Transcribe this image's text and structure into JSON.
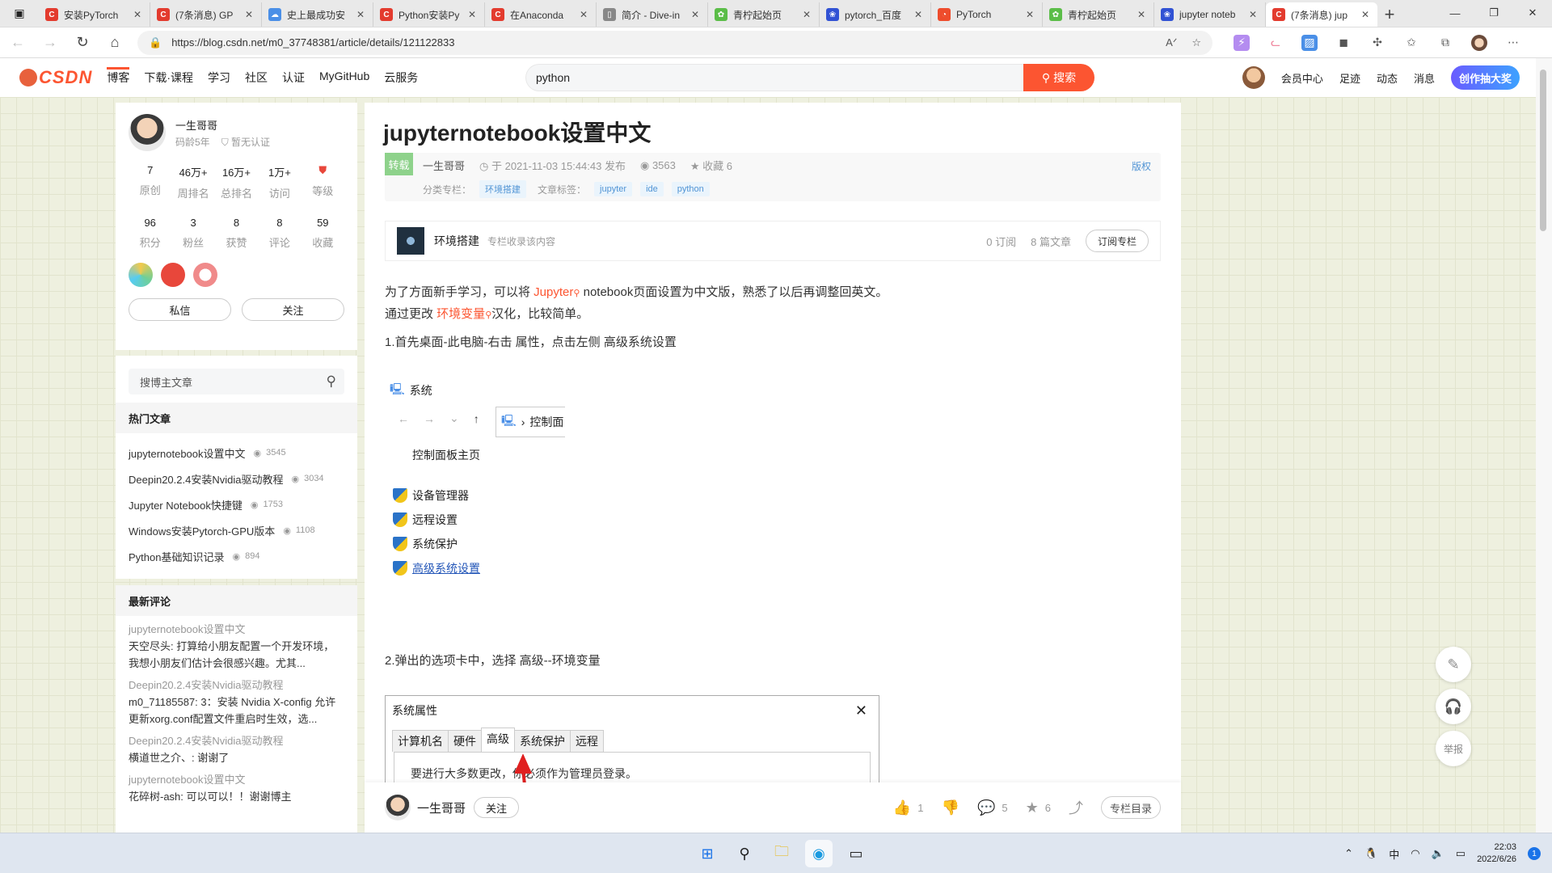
{
  "browser": {
    "tabs": [
      {
        "title": "安装PyTorch",
        "color": "#e33b2e",
        "glyph": "C"
      },
      {
        "title": "(7条消息) GP",
        "color": "#e33b2e",
        "glyph": "C"
      },
      {
        "title": "史上最成功安",
        "color": "#4a8fe7",
        "glyph": "☁"
      },
      {
        "title": "Python安装Py",
        "color": "#e33b2e",
        "glyph": "C"
      },
      {
        "title": "在Anaconda",
        "color": "#e33b2e",
        "glyph": "C"
      },
      {
        "title": "简介 - Dive-in",
        "color": "#888888",
        "glyph": "▯"
      },
      {
        "title": "青柠起始页",
        "color": "#5bbd48",
        "glyph": "✿"
      },
      {
        "title": "pytorch_百度",
        "color": "#3152d4",
        "glyph": "❀"
      },
      {
        "title": "PyTorch",
        "color": "#ee4c2c",
        "glyph": "◔"
      },
      {
        "title": "青柠起始页",
        "color": "#5bbd48",
        "glyph": "✿"
      },
      {
        "title": "jupyter noteb",
        "color": "#3152d4",
        "glyph": "❀"
      },
      {
        "title": "(7条消息) jup",
        "color": "#e33b2e",
        "glyph": "C"
      }
    ],
    "url": "https://blog.csdn.net/m0_37748381/article/details/121122833"
  },
  "csdn": {
    "logo": "CSDN",
    "nav": [
      "博客",
      "下载·课程",
      "学习",
      "社区",
      "认证",
      "MyGitHub",
      "云服务"
    ],
    "search_value": "python",
    "search_btn": "搜索",
    "right": [
      "会员中心",
      "足迹",
      "动态",
      "消息"
    ],
    "create_btn": "创作抽大奖"
  },
  "profile": {
    "name": "一生哥哥",
    "age": "码龄5年",
    "cert": "暂无认证",
    "stats": [
      {
        "v": "7",
        "l": "原创"
      },
      {
        "v": "46万+",
        "l": "周排名"
      },
      {
        "v": "16万+",
        "l": "总排名"
      },
      {
        "v": "1万+",
        "l": "访问"
      },
      {
        "v": "",
        "l": "等级"
      },
      {
        "v": "96",
        "l": "积分"
      },
      {
        "v": "3",
        "l": "粉丝"
      },
      {
        "v": "8",
        "l": "获赞"
      },
      {
        "v": "8",
        "l": "评论"
      },
      {
        "v": "59",
        "l": "收藏"
      }
    ],
    "btn_msg": "私信",
    "btn_follow": "关注"
  },
  "sidebar": {
    "search_placeholder": "搜博主文章",
    "hot_title": "热门文章",
    "hot": [
      {
        "t": "jupyternotebook设置中文",
        "v": "3545"
      },
      {
        "t": "Deepin20.2.4安装Nvidia驱动教程",
        "v": "3034"
      },
      {
        "t": "Jupyter Notebook快捷键",
        "v": "1753"
      },
      {
        "t": "Windows安装Pytorch-GPU版本",
        "v": "1108"
      },
      {
        "t": "Python基础知识记录",
        "v": "894"
      }
    ],
    "comments_title": "最新评论",
    "comments": [
      {
        "t": "jupyternotebook设置中文",
        "c": "天空尽头: 打算给小朋友配置一个开发环境，我想小朋友们估计会很感兴趣。尤其..."
      },
      {
        "t": "Deepin20.2.4安装Nvidia驱动教程",
        "c": "m0_71185587: 3：安装 Nvidia X-config 允许更新xorg.conf配置文件重启时生效，选..."
      },
      {
        "t": "Deepin20.2.4安装Nvidia驱动教程",
        "c": "横道世之介、: 谢谢了"
      },
      {
        "t": "jupyternotebook设置中文",
        "c": "花碎树-ash: 可以可以！！谢谢博主"
      }
    ]
  },
  "article": {
    "title": "jupyternotebook设置中文",
    "badge": "转载",
    "author": "一生哥哥",
    "date": "于 2021-11-03 15:44:43 发布",
    "views": "3563",
    "fav": "收藏 6",
    "copyright": "版权",
    "cat_label": "分类专栏：",
    "cat": "环境搭建",
    "tag_label": "文章标签：",
    "tags": [
      "jupyter",
      "ide",
      "python"
    ],
    "column_name": "环境搭建",
    "column_desc": "专栏收录该内容",
    "column_subs": "0 订阅",
    "column_count": "8 篇文章",
    "column_btn": "订阅专栏",
    "p1a": "为了方面新手学习，可以将 ",
    "p1link": "Jupyter",
    "p1b": " notebook页面设置为中文版，熟悉了以后再调整回英文。",
    "p2a": "通过更改 ",
    "p2link": "环境变量",
    "p2b": "汉化，比较简单。",
    "step1": "1.首先桌面-此电脑-右击 属性，点击左侧 高级系统设置",
    "shot1": {
      "title": "系统",
      "crumb": "控制面",
      "home": "控制面板主页",
      "items": [
        "设备管理器",
        "远程设置",
        "系统保护",
        "高级系统设置"
      ]
    },
    "step2": "2.弹出的选项卡中，选择 高级--环境变量",
    "shot2": {
      "title": "系统属性",
      "tabs": [
        "计算机名",
        "硬件",
        "高级",
        "系统保护",
        "远程"
      ],
      "text": "要进行大多数更改，你必须作为管理员登录。"
    }
  },
  "bottombar": {
    "name": "一生哥哥",
    "follow": "关注",
    "likes": "1",
    "comments": "5",
    "favs": "6",
    "dir": "专栏目录"
  },
  "floats": {
    "report": "举报"
  },
  "taskbar": {
    "time": "22:03",
    "date": "2022/6/26",
    "ime": "中",
    "notif": "1"
  }
}
